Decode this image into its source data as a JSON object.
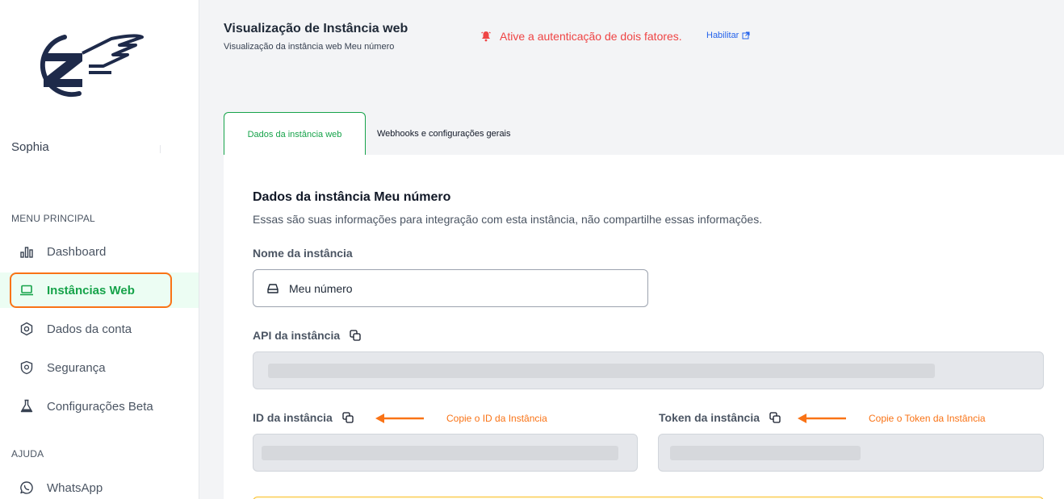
{
  "sidebar": {
    "user_name": "Sophia",
    "sections": {
      "main": "MENU PRINCIPAL",
      "help": "AJUDA"
    },
    "items": [
      {
        "label": "Dashboard",
        "icon": "bar-chart-icon"
      },
      {
        "label": "Instâncias Web",
        "icon": "laptop-icon"
      },
      {
        "label": "Dados da conta",
        "icon": "gear-icon"
      },
      {
        "label": "Segurança",
        "icon": "shield-icon"
      },
      {
        "label": "Configurações Beta",
        "icon": "flask-icon"
      },
      {
        "label": "WhatsApp",
        "icon": "whatsapp-icon"
      }
    ]
  },
  "header": {
    "title": "Visualização de Instância web",
    "subtitle": "Visualização da instância web Meu número",
    "alert_text": "Ative a autenticação de dois fatores.",
    "alert_link": "Habilitar"
  },
  "tabs": [
    {
      "label": "Dados da instância web"
    },
    {
      "label": "Webhooks e configurações gerais"
    }
  ],
  "panel": {
    "title": "Dados da instância Meu número",
    "description": "Essas são suas informações para integração com esta instância, não compartilhe essas informações.",
    "fields": {
      "name": {
        "label": "Nome da instância",
        "value": "Meu número"
      },
      "api": {
        "label": "API da instância"
      },
      "id": {
        "label": "ID da instância"
      },
      "token": {
        "label": "Token da instância"
      }
    }
  },
  "annotations": {
    "copy_id": "Copie o ID da Instância",
    "copy_token": "Copie o Token da Instância"
  },
  "colors": {
    "accent_green": "#16a34a",
    "alert_red": "#ef4444",
    "annotation_orange": "#f97316",
    "link_blue": "#2563eb",
    "brand_navy": "#1e2a4a"
  }
}
